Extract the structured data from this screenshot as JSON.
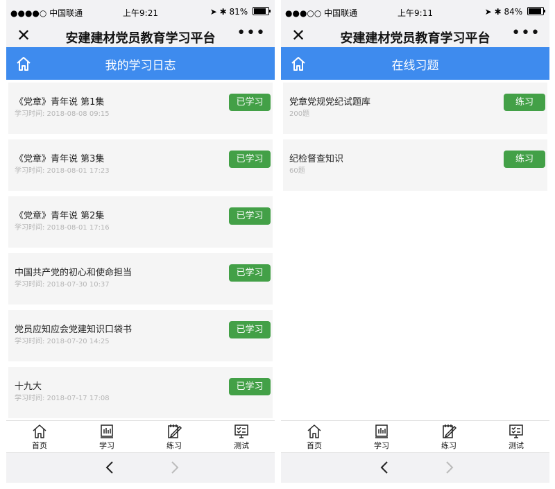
{
  "screens": [
    {
      "status": {
        "carrier": "●●●●○ 中国联通",
        "time": "上午9:21",
        "battery": "81%",
        "battery_level": 0.81
      },
      "app_title": "安建建材党员教育学习平台",
      "section_title": "我的学习日志",
      "items": [
        {
          "title": "《党章》青年说 第1集",
          "meta": "学习时间:   2018-08-08 09:15",
          "button": "已学习"
        },
        {
          "title": "《党章》青年说 第3集",
          "meta": "学习时间:   2018-08-01 17:23",
          "button": "已学习"
        },
        {
          "title": "《党章》青年说 第2集",
          "meta": "学习时间:   2018-08-01 17:16",
          "button": "已学习"
        },
        {
          "title": "中国共产党的初心和使命担当",
          "meta": "学习时间:   2018-07-30 10:37",
          "button": "已学习"
        },
        {
          "title": "党员应知应会党建知识口袋书",
          "meta": "学习时间:   2018-07-20 14:25",
          "button": "已学习"
        },
        {
          "title": "十九大",
          "meta": "学习时间:   2018-07-17 17:08",
          "button": "已学习"
        }
      ],
      "tabs": [
        {
          "label": "首页",
          "icon": "home-icon"
        },
        {
          "label": "学习",
          "icon": "book-icon"
        },
        {
          "label": "练习",
          "icon": "pencil-notebook-icon"
        },
        {
          "label": "测试",
          "icon": "test-monitor-icon"
        }
      ]
    },
    {
      "status": {
        "carrier": "●●●○○ 中国联通",
        "time": "上午9:11",
        "battery": "84%",
        "battery_level": 0.84
      },
      "app_title": "安建建材党员教育学习平台",
      "section_title": "在线习题",
      "items": [
        {
          "title": "党章党规党纪试题库",
          "meta": "200题",
          "button": "练习"
        },
        {
          "title": "纪检督查知识",
          "meta": "60题",
          "button": "练习"
        }
      ],
      "tabs": [
        {
          "label": "首页",
          "icon": "home-icon"
        },
        {
          "label": "学习",
          "icon": "book-icon"
        },
        {
          "label": "练习",
          "icon": "pencil-notebook-icon"
        },
        {
          "label": "测试",
          "icon": "test-monitor-icon"
        }
      ]
    }
  ],
  "colors": {
    "accent_blue": "#3e8bee",
    "button_green": "#43a047",
    "card_bg": "#f5f5f5",
    "bar_bg": "#f2f2f4"
  }
}
